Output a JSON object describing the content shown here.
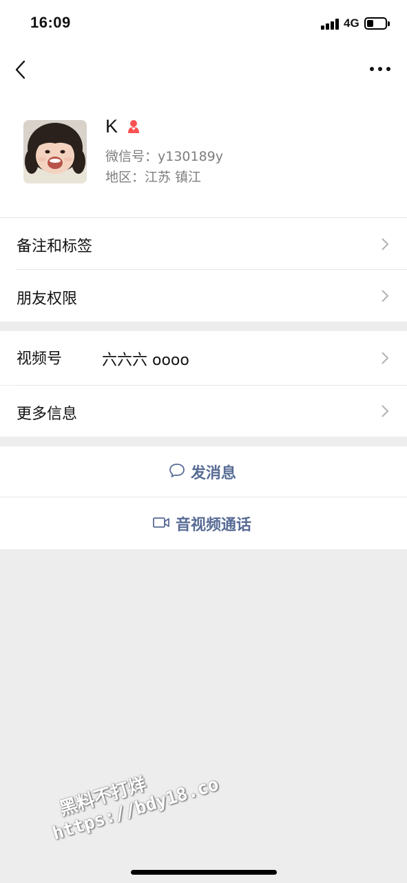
{
  "status_bar": {
    "time": "16:09",
    "network": "4G",
    "battery_level": 0.35,
    "signal_bars": 4
  },
  "nav": {
    "back_icon": "chevron-left-icon",
    "more_icon": "ellipsis-icon"
  },
  "profile": {
    "name": "K",
    "gender_icon": "female-person-icon",
    "gender_color": "#fa5151",
    "wechat_id": "微信号：y130189y",
    "region": "地区：江苏 镇江"
  },
  "list": {
    "remark_tags": "备注和标签",
    "friend_permissions": "朋友权限",
    "channels_label": "视频号",
    "channels_value": "六六六 oooo",
    "more_info": "更多信息"
  },
  "actions": {
    "send_message": "发消息",
    "video_call": "音视频通话",
    "accent_color": "#576b95"
  },
  "watermark": {
    "line1": "黑料不打烊",
    "line2": "https://bdy18.co"
  }
}
